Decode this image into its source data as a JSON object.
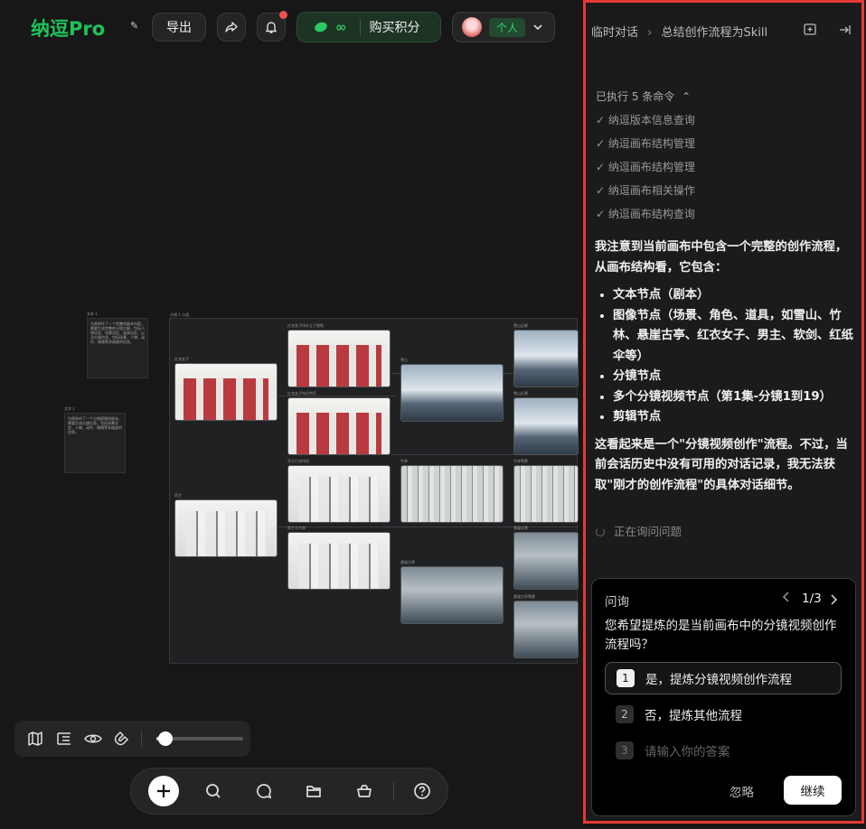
{
  "header": {
    "logo": "纳逗Pro",
    "export_label": "导出",
    "points_symbol": "∞",
    "buy_points_label": "购买积分",
    "account_label": "个人"
  },
  "canvas": {
    "note1_title": "文本 1",
    "note1_text": "为原则作了一个完整的剧本内容，需要生成完整的分镜大纲，包括人物设定、场景设定、道具设定，以及分镜信息，包括场景、人物、动作、情绪等多维度的信息。",
    "note2_title": "文本 2",
    "note2_text": "为原则作了一个分镜视频的剧本，需要生成分镜信息，包括场景设定、人物、动作，情绪等多维度的信息。",
    "frame_title": "分镜 1 分组",
    "img_labels": [
      "红衣女子",
      "男主",
      "红衣女子持伞立于雪地",
      "红衣女子持伞特写",
      "男主白衣持剑",
      "男主与竹林",
      "雪山",
      "竹林",
      "悬崖古亭",
      "雪山远景",
      "雪山近景",
      "竹林雪景",
      "悬崖远景",
      "悬崖古亭雪景"
    ]
  },
  "toolbar": {
    "zoom_percent": 10
  },
  "panel": {
    "breadcrumb_root": "临时对话",
    "breadcrumb_sep": "›",
    "breadcrumb_current": "总结创作流程为Skill",
    "executed_label": "已执行 5 条命令",
    "commands": [
      "纳逗版本信息查询",
      "纳逗画布结构管理",
      "纳逗画布结构管理",
      "纳逗画布相关操作",
      "纳逗画布结构查询"
    ],
    "intro": "我注意到当前画布中包含一个完整的创作流程，从画布结构看，它包含：",
    "bullets": [
      "文本节点（剧本）",
      "图像节点（场景、角色、道具，如雪山、竹林、悬崖古亭、红衣女子、男主、软剑、红纸伞等）",
      "分镜节点",
      "多个分镜视频节点（第1集-分镜1到19）",
      "剪辑节点"
    ],
    "conclusion": "这看起来是一个\"分镜视频创作\"流程。不过，当前会话历史中没有可用的对话记录，我无法获取\"刚才的创作流程\"的具体对话细节。",
    "status": "正在询问问题",
    "ask": {
      "title": "问询",
      "pager": "1/3",
      "question": "您希望提炼的是当前画布中的分镜视频创作流程吗？",
      "options": [
        {
          "num": "1",
          "label": "是，提炼分镜视频创作流程"
        },
        {
          "num": "2",
          "label": "否，提炼其他流程"
        },
        {
          "num": "3",
          "label": "请输入你的答案"
        }
      ],
      "ignore_label": "忽略",
      "continue_label": "继续"
    }
  }
}
